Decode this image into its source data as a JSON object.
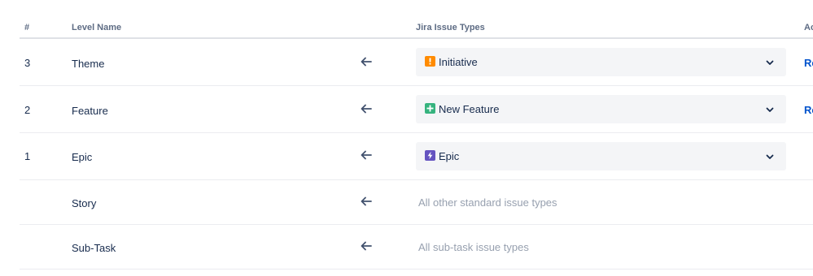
{
  "header": {
    "num": "#",
    "level_name": "Level Name",
    "issue_types": "Jira Issue Types",
    "actions": "Actions"
  },
  "rows": [
    {
      "num": "3",
      "name": "Theme",
      "issue_type": "Initiative",
      "icon": "initiative-icon",
      "icon_color": "#ff8b00",
      "action": "Remove"
    },
    {
      "num": "2",
      "name": "Feature",
      "issue_type": "New Feature",
      "icon": "new-feature-icon",
      "icon_color": "#36b37e",
      "action": "Remove"
    },
    {
      "num": "1",
      "name": "Epic",
      "issue_type": "Epic",
      "icon": "epic-icon",
      "icon_color": "#6554c0"
    },
    {
      "num": "",
      "name": "Story",
      "issue_type_text": "All other standard issue types"
    },
    {
      "num": "",
      "name": "Sub-Task",
      "issue_type_text": "All sub-task issue types"
    }
  ],
  "colors": {
    "link": "#0052cc",
    "muted_text": "#97a0af",
    "select_bg": "#f4f5f7"
  }
}
